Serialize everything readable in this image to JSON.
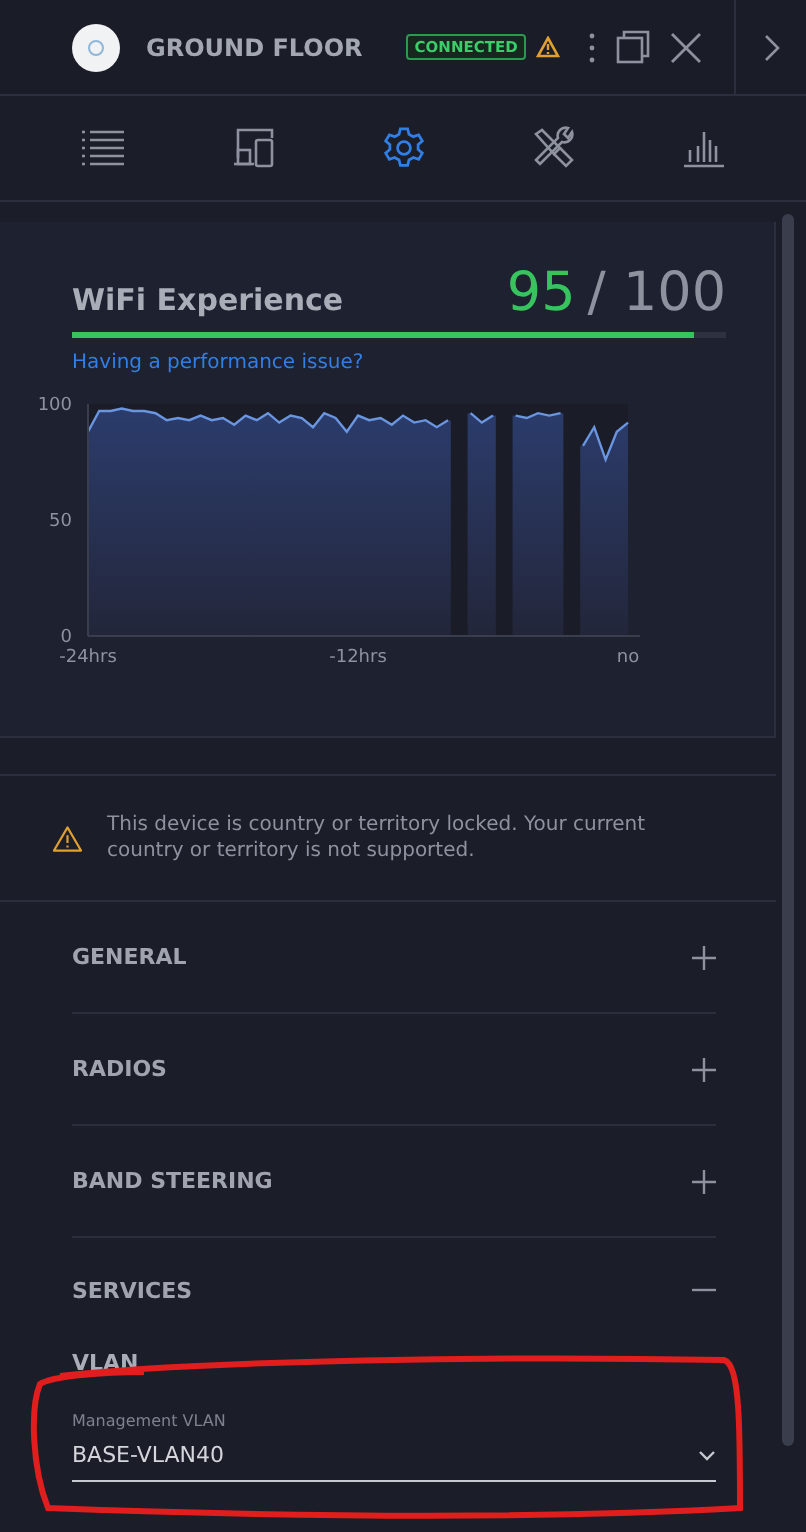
{
  "header": {
    "device_name": "GROUND FLOOR",
    "status_badge": "CONNECTED",
    "warning": true
  },
  "tabs": [
    {
      "kind": "list",
      "selected": false
    },
    {
      "kind": "devices",
      "selected": false
    },
    {
      "kind": "settings",
      "selected": true
    },
    {
      "kind": "tools",
      "selected": false
    },
    {
      "kind": "stats",
      "selected": false
    }
  ],
  "experience": {
    "title": "WiFi Experience",
    "score": "95",
    "max": "/ 100",
    "level": 0.95,
    "link": "Having a performance issue?",
    "chart_data": {
      "type": "area",
      "yticks": [
        0,
        50,
        100
      ],
      "ylim": [
        0,
        100
      ],
      "xlim": [
        -24,
        0
      ],
      "xticks": [
        {
          "value": -24,
          "label": "-24hrs"
        },
        {
          "value": -12,
          "label": "-12hrs"
        },
        {
          "value": 0,
          "label": "no"
        }
      ],
      "x": [
        -24,
        -23.5,
        -23,
        -22.5,
        -22,
        -21.5,
        -21,
        -20.5,
        -20,
        -19.5,
        -19,
        -18.5,
        -18,
        -17.5,
        -17,
        -16.5,
        -16,
        -15.5,
        -15,
        -14.5,
        -14,
        -13.5,
        -13,
        -12.5,
        -12,
        -11.5,
        -11,
        -10.5,
        -10,
        -9.5,
        -9,
        -8.5,
        -8,
        -7.5,
        -7,
        -6.5,
        -6,
        -5.5,
        -5,
        -4.5,
        -4,
        -3.5,
        -3,
        -2.5,
        -2,
        -1.5,
        -1,
        -0.5,
        0
      ],
      "series": [
        {
          "color": "#6a95e0",
          "values": [
            88,
            97,
            97,
            98,
            97,
            97,
            96,
            93,
            94,
            93,
            95,
            93,
            94,
            91,
            95,
            93,
            96,
            92,
            95,
            94,
            90,
            96,
            94,
            88,
            95,
            93,
            94,
            91,
            95,
            92,
            93,
            90,
            93,
            null,
            96,
            92,
            95,
            null,
            95,
            94,
            96,
            95,
            96,
            null,
            82,
            90,
            76,
            88,
            92
          ]
        }
      ]
    }
  },
  "notice": "This device is country or territory locked. Your current country or territory is not supported.",
  "sections": [
    {
      "label": "GENERAL",
      "expanded": false
    },
    {
      "label": "RADIOS",
      "expanded": false
    },
    {
      "label": "BAND STEERING",
      "expanded": false
    },
    {
      "label": "SERVICES",
      "expanded": true
    }
  ],
  "vlan": {
    "heading": "VLAN",
    "field_label": "Management VLAN",
    "value": "BASE-VLAN40"
  }
}
